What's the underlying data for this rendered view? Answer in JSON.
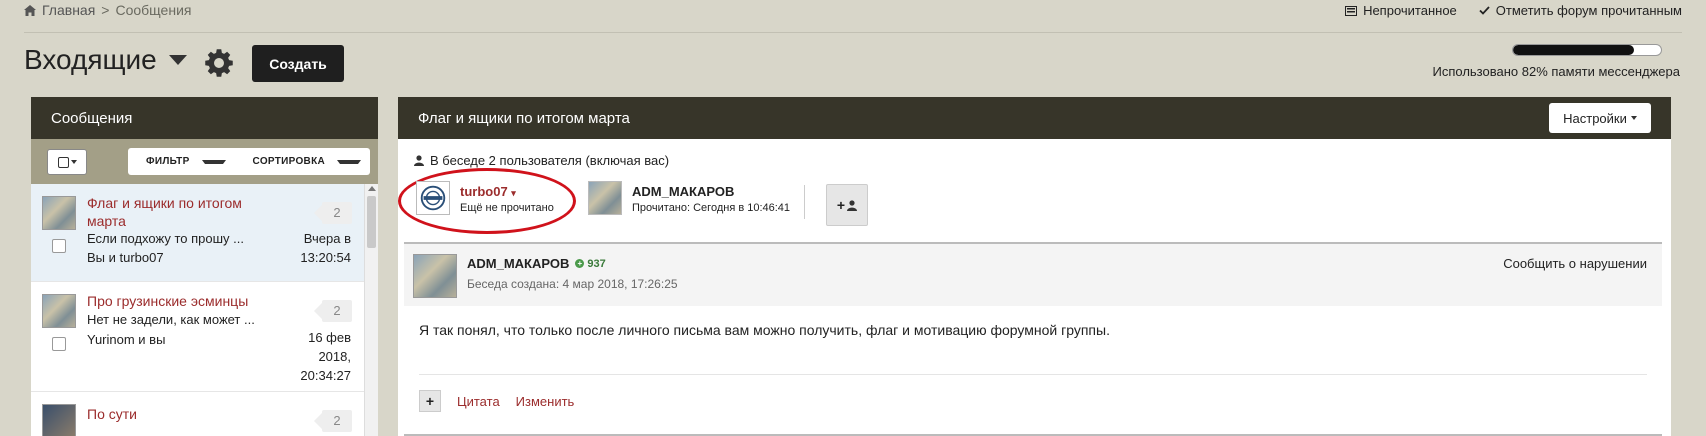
{
  "breadcrumb": {
    "home": "Главная",
    "separator": ">",
    "current": "Сообщения"
  },
  "top_actions": {
    "unread": "Непрочитанное",
    "mark_read": "Отметить форум прочитанным"
  },
  "page": {
    "title": "Входящие",
    "create_label": "Создать"
  },
  "memory": {
    "percent": 82,
    "text": "Использовано 82% памяти мессенджера"
  },
  "left_panel": {
    "header": "Сообщения",
    "filter_label": "ФИЛЬТР",
    "sort_label": "СОРТИРОВКА",
    "messages": [
      {
        "title": "Флаг и ящики по итогом марта",
        "snippet": "Если подхожу то прошу ...",
        "people": "Вы и turbo07",
        "count": "2",
        "date": "Вчера в 13:20:54"
      },
      {
        "title": "Про грузинские эсминцы",
        "snippet": "Нет не задели, как может ...",
        "people": "Yurinom и вы",
        "count": "2",
        "date": "16 фев 2018, 20:34:27"
      },
      {
        "title": "По сути",
        "snippet": "",
        "people": "",
        "count": "2",
        "date": ""
      }
    ]
  },
  "conversation": {
    "title": "Флаг и ящики по итогом марта",
    "settings_label": "Настройки",
    "info": "В беседе 2 пользователя (включая вас)",
    "participants": [
      {
        "name": "turbo07",
        "status": "Ещё не прочитано"
      },
      {
        "name": "ADM_МАКАРОВ",
        "status": "Прочитано: Сегодня в 10:46:41"
      }
    ],
    "post": {
      "author": "ADM_МАКАРОВ",
      "reputation": "937",
      "created": "Беседа создана: 4 мар 2018, 17:26:25",
      "report": "Сообщить о нарушении",
      "body": "Я так понял, что только после личного письма вам можно получить, флаг и мотивацию форумной группы.",
      "quote": "Цитата",
      "edit": "Изменить"
    }
  },
  "colors": {
    "header_bg": "#373529",
    "accent_link": "#9b2c2c",
    "page_bg": "#d8d6c9",
    "highlight": "#d0121b"
  }
}
